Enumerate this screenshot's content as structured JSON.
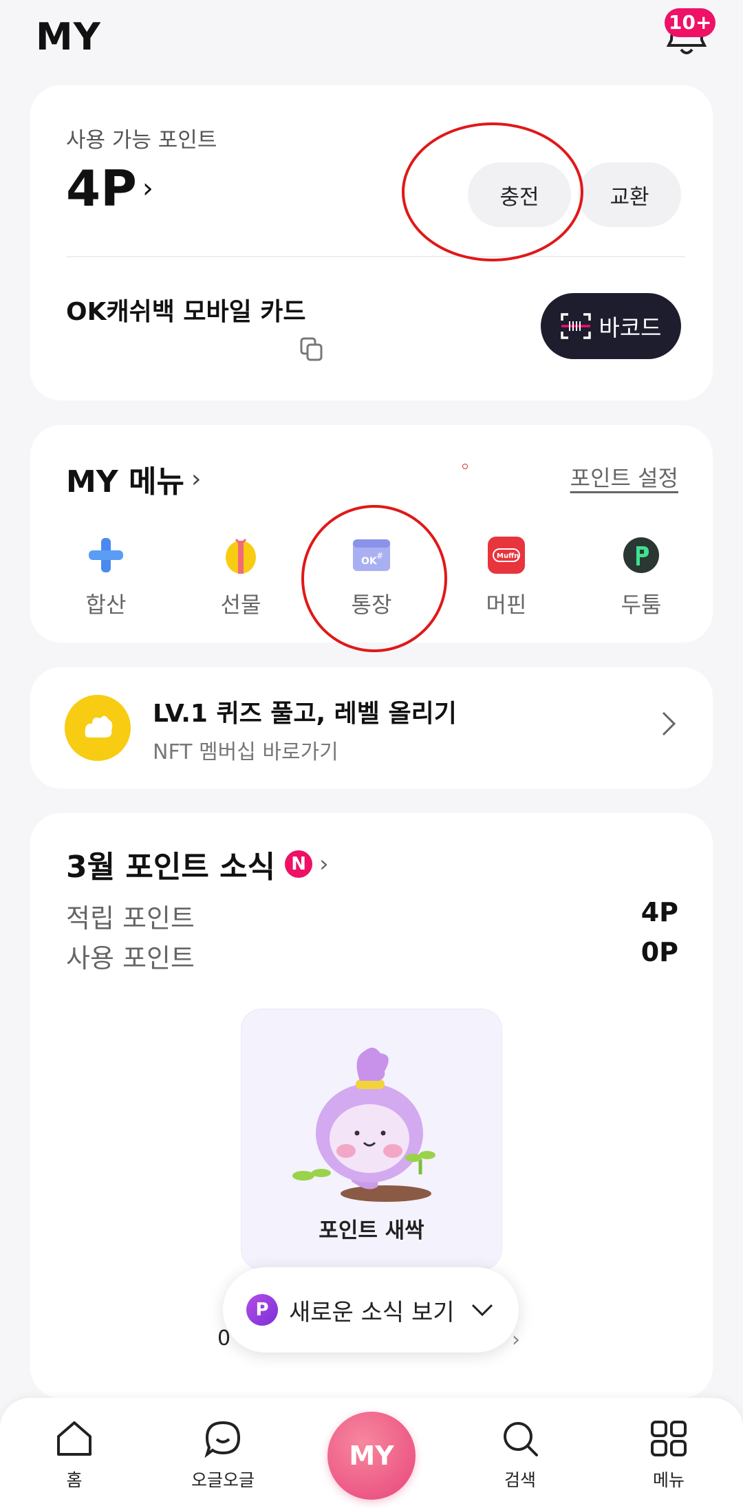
{
  "header": {
    "title": "MY",
    "badge": "10+"
  },
  "points_card": {
    "label": "사용 가능 포인트",
    "value": "4P",
    "charge_button": "충전",
    "exchange_button": "교환",
    "card_name": "OK캐쉬백 모바일 카드",
    "barcode_button": "바코드"
  },
  "my_menu": {
    "title": "MY 메뉴",
    "settings_link": "포인트 설정",
    "items": [
      {
        "label": "합산",
        "icon": "plus-icon"
      },
      {
        "label": "선물",
        "icon": "gift-icon"
      },
      {
        "label": "통장",
        "icon": "bankbook-icon"
      },
      {
        "label": "머핀",
        "icon": "muffin-icon"
      },
      {
        "label": "두툼",
        "icon": "dootoom-icon"
      }
    ]
  },
  "quiz_banner": {
    "title": "LV.1 퀴즈 풀고, 레벨 올리기",
    "subtitle": "NFT 멤버십 바로가기"
  },
  "news": {
    "title": "3월 포인트 소식",
    "badge": "N",
    "earned_label": "적립 포인트",
    "earned_value": "4P",
    "used_label": "사용 포인트",
    "used_value": "0P",
    "sprout_label": "포인트 새싹",
    "behind_text": "0"
  },
  "popup": {
    "icon_letter": "P",
    "label": "새로운 소식 보기"
  },
  "bottom_nav": {
    "home": "홈",
    "ogeul": "오글오글",
    "my": "MY",
    "search": "검색",
    "menu": "메뉴"
  },
  "colors": {
    "accent_pink": "#ee1166",
    "barcode_dark": "#1e1d2e",
    "yellow": "#f7cc12",
    "annotation_red": "#e01818"
  }
}
